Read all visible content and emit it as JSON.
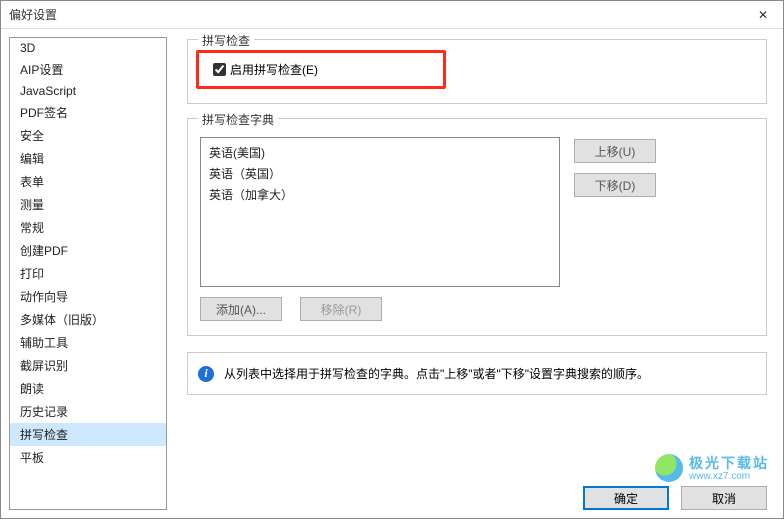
{
  "window": {
    "title": "偏好设置",
    "close_icon": "✕"
  },
  "sidebar": {
    "items": [
      {
        "label": "3D"
      },
      {
        "label": "AIP设置"
      },
      {
        "label": "JavaScript"
      },
      {
        "label": "PDF签名"
      },
      {
        "label": "安全"
      },
      {
        "label": "编辑"
      },
      {
        "label": "表单"
      },
      {
        "label": "测量"
      },
      {
        "label": "常规"
      },
      {
        "label": "创建PDF"
      },
      {
        "label": "打印"
      },
      {
        "label": "动作向导"
      },
      {
        "label": "多媒体（旧版）"
      },
      {
        "label": "辅助工具"
      },
      {
        "label": "截屏识别"
      },
      {
        "label": "朗读"
      },
      {
        "label": "历史记录"
      },
      {
        "label": "拼写检查",
        "selected": true
      },
      {
        "label": "平板"
      }
    ]
  },
  "spellcheck": {
    "group_label": "拼写检查",
    "enable_label": "启用拼写检查(E)",
    "enable_checked": true
  },
  "dictionary": {
    "group_label": "拼写检查字典",
    "items": [
      "英语(美国)",
      "英语（英国）",
      "英语（加拿大）"
    ],
    "move_up": "上移(U)",
    "move_down": "下移(D)",
    "add": "添加(A)...",
    "remove": "移除(R)"
  },
  "info": {
    "text": "从列表中选择用于拼写检查的字典。点击\"上移\"或者\"下移\"设置字典搜索的顺序。"
  },
  "footer": {
    "ok": "确定",
    "cancel": "取消"
  },
  "watermark": {
    "cn": "极光下载站",
    "url": "www.xz7.com"
  }
}
